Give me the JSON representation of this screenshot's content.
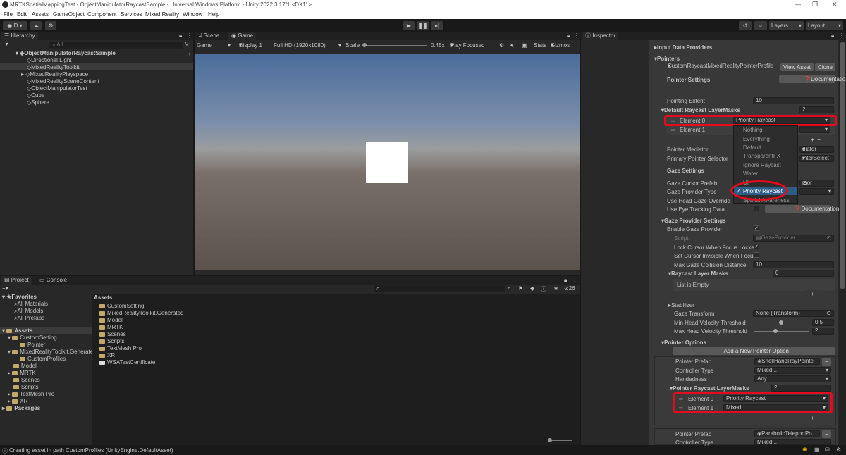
{
  "window": {
    "title": "MRTKSpatialMappingTest - ObjectManipulatorRaycastSample - Universal Windows Platform - Unity 2022.3.17f1 <DX11>"
  },
  "menu": [
    "File",
    "Edit",
    "Assets",
    "GameObject",
    "Component",
    "Services",
    "Mixed Reality",
    "Window",
    "Help"
  ],
  "toolbar": {
    "account": "D",
    "layers": "Layers",
    "layout": "Layout"
  },
  "hierarchy": {
    "tab": "Hierarchy",
    "search_placeholder": "All",
    "scene": "ObjectManipulatorRaycastSample",
    "items": [
      "Directional Light",
      "MixedRealityToolkit",
      "MixedRealityPlayspace",
      "MixedRealitySceneContent",
      "ObjectManipulatorTest",
      "Cube",
      "Sphere"
    ]
  },
  "game": {
    "tab_scene": "Scene",
    "tab_game": "Game",
    "mode": "Game",
    "display": "Display 1",
    "resolution": "Full HD (1920x1080)",
    "scale_label": "Scale",
    "scale_value": "0.45x",
    "play_focused": "Play Focused",
    "stats": "Stats",
    "gizmos": "Gizmos"
  },
  "project": {
    "tab_project": "Project",
    "tab_console": "Console",
    "count": "26",
    "favorites": "Favorites",
    "fav_items": [
      "All Materials",
      "All Models",
      "All Prefabs"
    ],
    "assets_root": "Assets",
    "tree": [
      "CustomSetting",
      "Pointer",
      "MixedRealityToolkit.Generated",
      "CustomProfiles",
      "Model",
      "MRTK",
      "Scenes",
      "Scripts",
      "TextMesh Pro",
      "XR",
      "Packages"
    ],
    "breadcrumb": "Assets",
    "files": [
      "CustomSetting",
      "MixedRealityToolkit.Generated",
      "Model",
      "MRTK",
      "Scenes",
      "Scripts",
      "TextMesh Pro",
      "XR",
      "WSATestCertificate"
    ]
  },
  "inspector": {
    "tab": "Inspector",
    "input_data_providers": "Input Data Providers",
    "pointers": "Pointers",
    "profile": "CustomRaycastMixedRealityPointerProfile",
    "view_asset": "View Asset",
    "clone": "Clone",
    "pointer_settings": "Pointer Settings",
    "documentation": "Documentation",
    "pointing_extent_label": "Pointing Extent",
    "pointing_extent": "10",
    "default_masks_label": "Default Raycast LayerMasks",
    "default_masks_count": "2",
    "element0": "Element 0",
    "element0_value": "Priority Raycast",
    "element1": "Element 1",
    "pointer_mediator": "Pointer Mediator",
    "pointer_mediator_value": "diator",
    "primary_pointer_selector": "Primary Pointer Selector",
    "primary_pointer_value": "interSelect",
    "gaze_settings": "Gaze Settings",
    "gaze_cursor_prefab": "Gaze Cursor Prefab",
    "gaze_cursor_value": "rsor",
    "gaze_provider_type": "Gaze Provider Type",
    "use_head_gaze_override": "Use Head Gaze Override",
    "use_eye_tracking_data": "Use Eye Tracking Data",
    "gaze_provider_settings": "Gaze Provider Settings",
    "enable_gaze_provider": "Enable Gaze Provider",
    "script": "Script",
    "script_value": "GazeProvider",
    "lock_cursor": "Lock Cursor When Focus Locke",
    "set_cursor_invisible": "Set Cursor Invisible When Focus",
    "max_gaze_distance_label": "Max Gaze Collision Distance",
    "max_gaze_distance": "10",
    "raycast_layer_masks": "Raycast Layer Masks",
    "raycast_layer_masks_count": "0",
    "list_empty": "List is Empty",
    "stabilizer": "Stabilizer",
    "gaze_transform": "Gaze Transform",
    "gaze_transform_value": "None (Transform)",
    "min_head_vel": "Min Head Velocity Threshold",
    "min_head_vel_value": "0.5",
    "max_head_vel": "Max Head Velocity Threshold",
    "max_head_vel_value": "2",
    "pointer_options": "Pointer Options",
    "add_pointer_option": "+ Add a New Pointer Option",
    "pointer_prefab": "Pointer Prefab",
    "pointer_prefab_value": "ShellHandRayPointe",
    "controller_type": "Controller Type",
    "controller_type_value": "Mixed...",
    "handedness": "Handedness",
    "handedness_value": "Any",
    "pointer_masks": "Pointer Raycast LayerMasks",
    "pointer_masks_count": "2",
    "p_element0": "Element 0",
    "p_element0_value": "Priority Raycast",
    "p_element1": "Element 1",
    "p_element1_value": "Mixed...",
    "pointer_prefab2_value": "ParabolicTeleportPo",
    "controller_type2_value": "Mixed..."
  },
  "dropdown": {
    "items": [
      "Nothing",
      "Everything",
      "Default",
      "TransparentFX",
      "Ignore Raycast",
      "Water",
      "UI",
      "Priority Raycast",
      "Spatial Awareness"
    ],
    "selected": "Priority Raycast"
  },
  "status": {
    "message": "Creating asset in path CustomProfiles (UnityEngine.DefaultAsset)"
  }
}
